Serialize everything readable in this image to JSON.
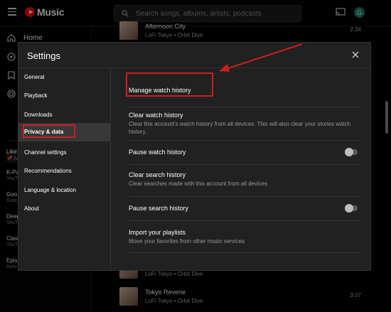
{
  "app": {
    "logo_text": "Music",
    "search_placeholder": "Search songs, albums, artists, podcasts",
    "avatar_letter": "G",
    "accent_color": "#ff0000"
  },
  "sidebar": {
    "items": [
      {
        "label": "Home",
        "icon": "home-icon"
      },
      {
        "label": "",
        "icon": "explore-icon"
      },
      {
        "label": "",
        "icon": "library-icon"
      },
      {
        "label": "",
        "icon": "upgrade-icon"
      }
    ],
    "library": [
      {
        "title": "Like",
        "sub": "📌 Au"
      },
      {
        "title": "K-Po",
        "sub": "YouT"
      },
      {
        "title": "Goo",
        "sub": "Grac"
      },
      {
        "title": "Deep",
        "sub": "YouT"
      },
      {
        "title": "Clas",
        "sub": "YouT"
      },
      {
        "title": "Epis",
        "sub": "Auto"
      }
    ]
  },
  "songs": [
    {
      "title": "Afternoon City",
      "sub": "LoFi Tokyo • Orbit Dive",
      "duration": "2:34"
    },
    {
      "title": "",
      "sub": "LoFi Tokyo • Orbit Dive",
      "duration": ""
    },
    {
      "title": "Tokyo Reverie",
      "sub": "LoFi Tokyo • Orbit Dive",
      "duration": "3:07"
    }
  ],
  "settings": {
    "title": "Settings",
    "menu": [
      "General",
      "Playback",
      "Downloads",
      "Privacy & data",
      "Channel settings",
      "Recommendations",
      "Language & location",
      "About"
    ],
    "active_index": 3,
    "options": [
      {
        "title": "Manage watch history",
        "desc": ""
      },
      {
        "title": "Clear watch history",
        "desc": "Clear this account's watch history from all devices. This will also clear your stories watch history."
      },
      {
        "title": "Pause watch history",
        "desc": "",
        "toggle": false
      },
      {
        "title": "Clear search history",
        "desc": "Clear searches made with this account from all devices"
      },
      {
        "title": "Pause search history",
        "desc": "",
        "toggle": false
      },
      {
        "title": "Import your playlists",
        "desc": "Move your favorites from other music services"
      }
    ]
  },
  "annotations": {
    "color": "#cc1f1f"
  }
}
